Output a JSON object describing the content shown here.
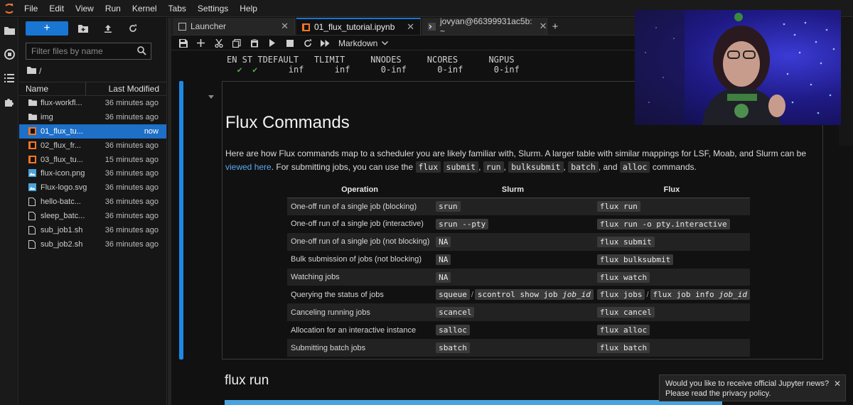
{
  "menu": [
    "File",
    "Edit",
    "View",
    "Run",
    "Kernel",
    "Tabs",
    "Settings",
    "Help"
  ],
  "filebrowser": {
    "new_label": "+",
    "filter_placeholder": "Filter files by name",
    "path": "/",
    "col_name": "Name",
    "col_modified": "Last Modified",
    "files": [
      {
        "name": "flux-workfl...",
        "modified": "36 minutes ago",
        "icon": "folder-icon"
      },
      {
        "name": "img",
        "modified": "36 minutes ago",
        "icon": "folder-icon"
      },
      {
        "name": "01_flux_tu...",
        "modified": "now",
        "icon": "notebook-icon"
      },
      {
        "name": "02_flux_fr...",
        "modified": "36 minutes ago",
        "icon": "notebook-icon"
      },
      {
        "name": "03_flux_tu...",
        "modified": "15 minutes ago",
        "icon": "notebook-icon"
      },
      {
        "name": "flux-icon.png",
        "modified": "36 minutes ago",
        "icon": "image-icon"
      },
      {
        "name": "Flux-logo.svg",
        "modified": "36 minutes ago",
        "icon": "image-icon"
      },
      {
        "name": "hello-batc...",
        "modified": "36 minutes ago",
        "icon": "file-icon"
      },
      {
        "name": "sleep_batc...",
        "modified": "36 minutes ago",
        "icon": "file-icon"
      },
      {
        "name": "sub_job1.sh",
        "modified": "36 minutes ago",
        "icon": "file-icon"
      },
      {
        "name": "sub_job2.sh",
        "modified": "36 minutes ago",
        "icon": "file-icon"
      }
    ]
  },
  "tabs": [
    {
      "label": "Launcher",
      "icon": "launcher-icon"
    },
    {
      "label": "01_flux_tutorial.ipynb",
      "icon": "notebook-icon"
    },
    {
      "label": "jovyan@66399931ac5b: ~",
      "icon": "terminal-icon"
    }
  ],
  "toolbar": {
    "cell_type": "Markdown"
  },
  "output": {
    "header": "EN ST TDEFAULT   TLIMIT     NNODES     NCORES      NGPUS",
    "check1": "✔",
    "check2": "✔",
    "values": "inf      inf      0-inf      0-inf      0-inf"
  },
  "cell": {
    "title": "Flux Commands",
    "para_1": "Here are how Flux commands map to a scheduler you are likely familiar with, Slurm. A larger table with similar mappings for LSF, Moab, and Slurm can be",
    "link": "viewed here",
    "para_2": ". For submitting jobs, you can use the",
    "code_flux": "flux",
    "code_submit": "submit",
    "code_run": "run",
    "code_bulksubmit": "bulksubmit",
    "code_batch": "batch",
    "code_alloc": "alloc",
    "comma": ",",
    "and": ", and",
    "commands": "commands."
  },
  "table": {
    "headers": [
      "Operation",
      "Slurm",
      "Flux"
    ],
    "rows": [
      {
        "op": "One-off run of a single job (blocking)",
        "slurm": "srun",
        "flux": "flux run"
      },
      {
        "op": "One-off run of a single job (interactive)",
        "slurm": "srun --pty",
        "flux": "flux run -o pty.interactive"
      },
      {
        "op": "One-off run of a single job (not blocking)",
        "slurm": "NA",
        "flux": "flux submit"
      },
      {
        "op": "Bulk submission of jobs (not blocking)",
        "slurm": "NA",
        "flux": "flux bulksubmit"
      },
      {
        "op": "Watching jobs",
        "slurm": "NA",
        "flux": "flux watch"
      },
      {
        "op": "Querying the status of jobs",
        "slurm": "squeue",
        "slurm2": "scontrol show job",
        "slurm2_arg": "job_id",
        "flux": "flux jobs",
        "flux2": "flux job info",
        "flux2_arg": "job_id",
        "sep": "/"
      },
      {
        "op": "Canceling running jobs",
        "slurm": "scancel",
        "flux": "flux cancel"
      },
      {
        "op": "Allocation for an interactive instance",
        "slurm": "salloc",
        "flux": "flux alloc"
      },
      {
        "op": "Submitting batch jobs",
        "slurm": "sbatch",
        "flux": "flux batch"
      }
    ]
  },
  "next_heading": "flux run",
  "toast": {
    "line1": "Would you like to receive official Jupyter news?",
    "line2": "Please read the privacy policy."
  },
  "colors": {
    "accent": "#1976d2",
    "link": "#5aa8f0",
    "cell_bar": "#1e88e5"
  }
}
